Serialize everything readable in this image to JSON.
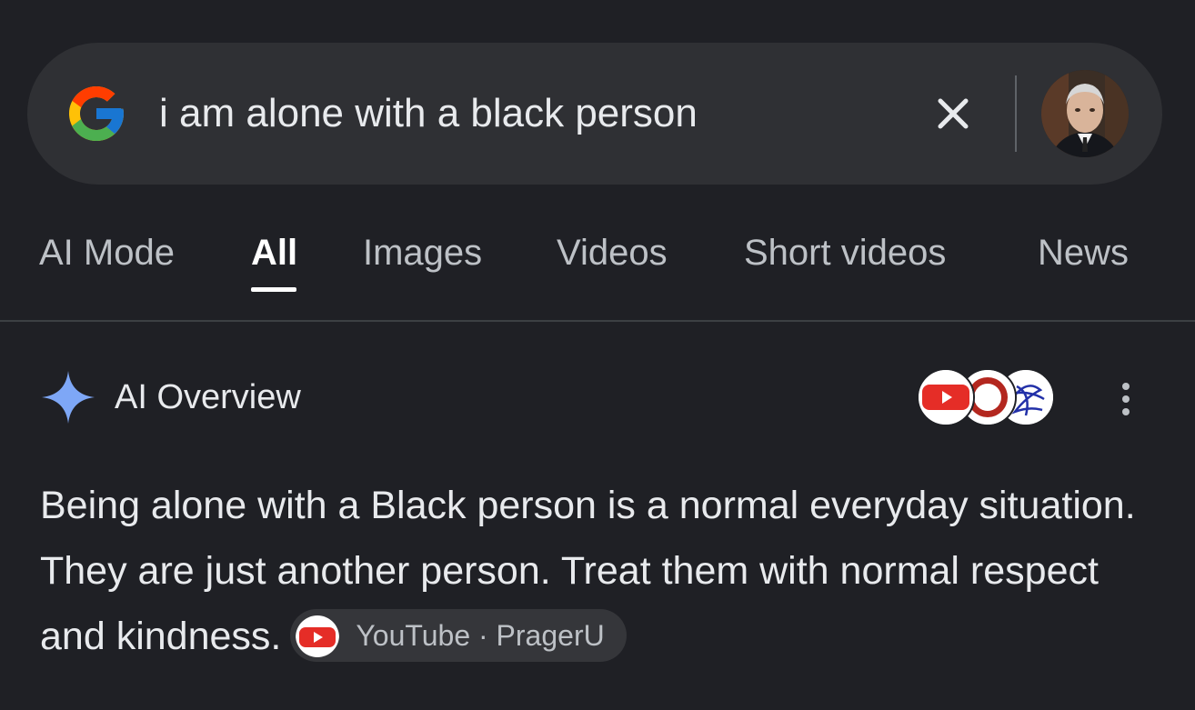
{
  "search": {
    "query": "i am alone with a black person"
  },
  "icons": {
    "logo": "google-g-icon",
    "clear": "close-icon",
    "avatar": "user-avatar",
    "ai": "sparkle-icon",
    "more": "more-vert-icon",
    "youtube": "youtube-icon"
  },
  "tabs": [
    {
      "label": "AI Mode"
    },
    {
      "label": "All"
    },
    {
      "label": "Images"
    },
    {
      "label": "Videos"
    },
    {
      "label": "Short videos"
    },
    {
      "label": "News"
    }
  ],
  "active_tab": "All",
  "ai_overview": {
    "title": "AI Overview",
    "text": "Being alone with a Black person is a normal everyday situation. They are just another person. Treat them with normal respect and kindness.",
    "citation": "YouTube · PragerU"
  },
  "colors": {
    "background": "#1f2025",
    "searchbar": "#2f3034",
    "youtube_red": "#e52d27",
    "spark": "#7ea7f6"
  }
}
